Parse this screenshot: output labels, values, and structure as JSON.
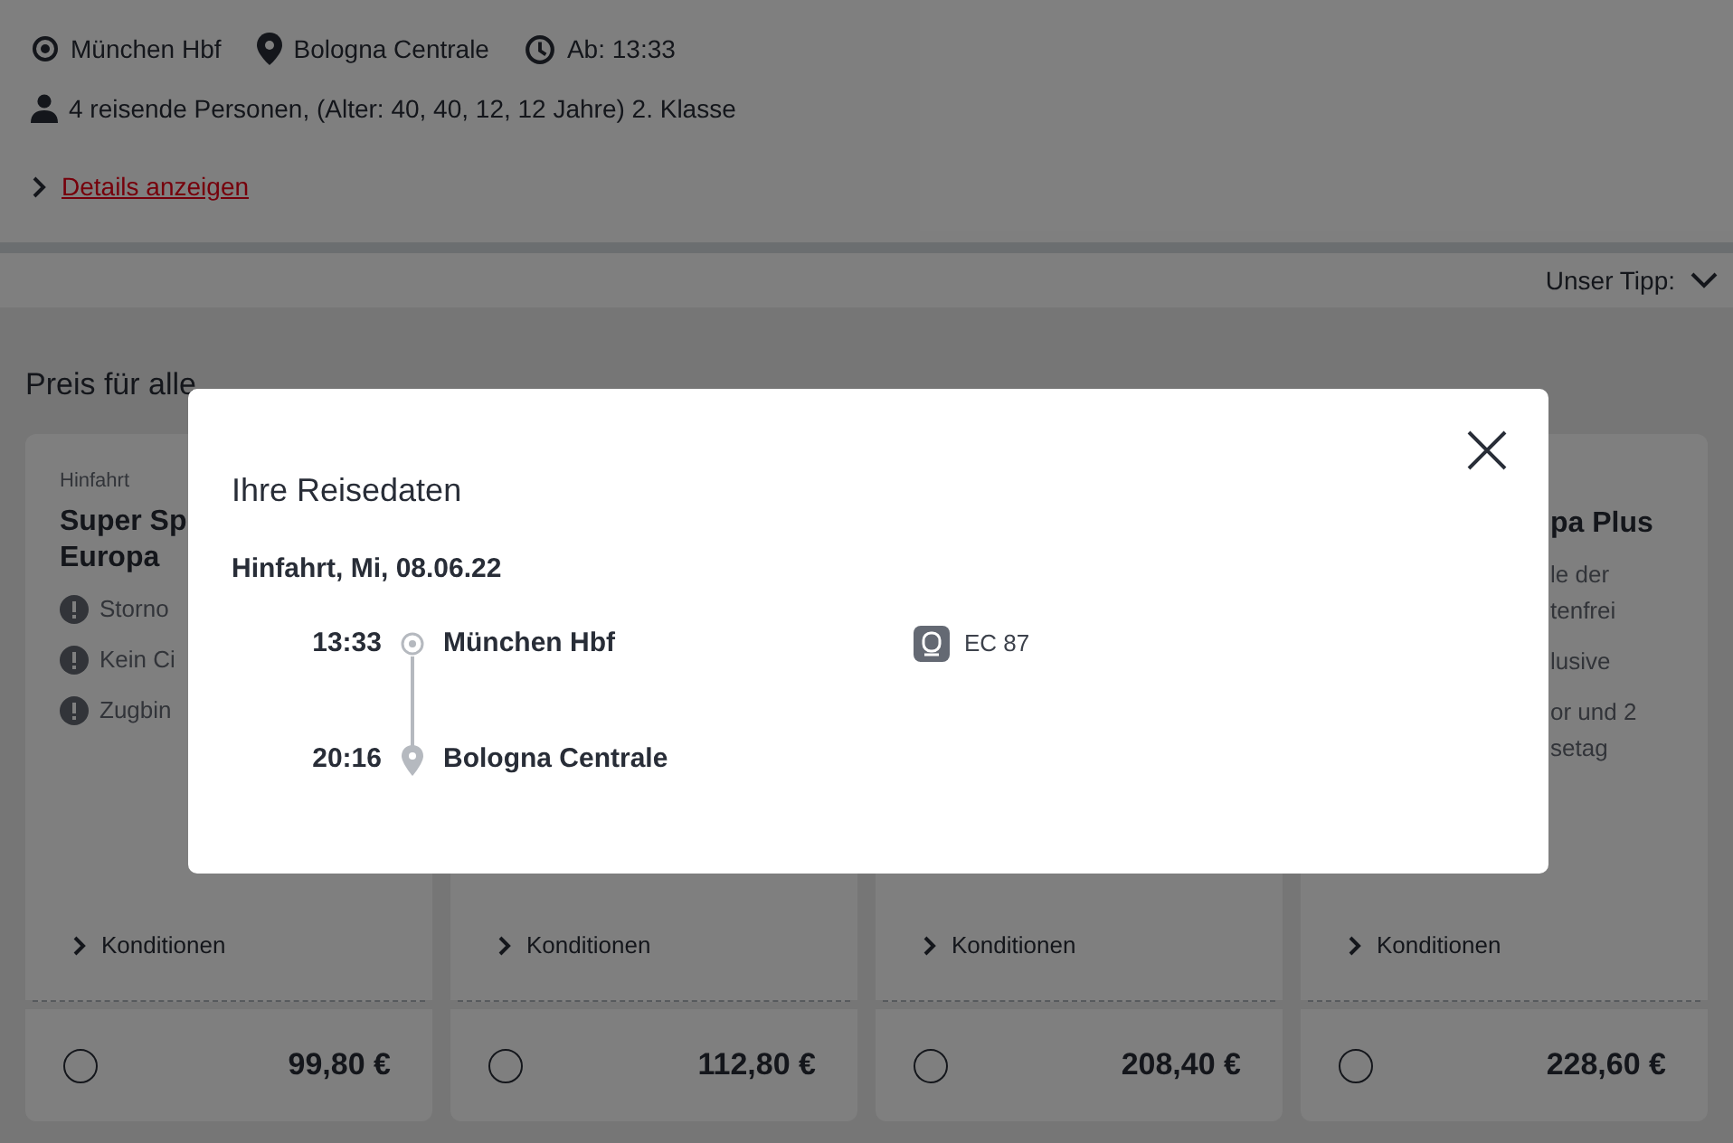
{
  "header": {
    "origin": "München Hbf",
    "destination": "Bologna Centrale",
    "departure": "Ab: 13:33",
    "travellers": "4 reisende Personen, (Alter: 40, 40, 12, 12 Jahre) 2. Klasse",
    "details_link": "Details anzeigen"
  },
  "sort": {
    "label": "Unser Tipp:"
  },
  "offers": {
    "heading": "Preis für alle",
    "cards": [
      {
        "kind": "left_visible",
        "direction": "Hinfahrt",
        "title_lines": [
          "Super Sp",
          "Europa"
        ],
        "features": [
          {
            "lines": [
              "Storno"
            ]
          },
          {
            "lines": [
              "Kein Ci"
            ]
          },
          {
            "lines": [
              "Zugbin"
            ]
          }
        ],
        "conditions": "Konditionen",
        "price": "99,80 €",
        "selected": false
      },
      {
        "kind": "hidden",
        "conditions": "Konditionen",
        "price": "112,80 €",
        "selected": false
      },
      {
        "kind": "hidden",
        "conditions": "Konditionen",
        "price": "208,40 €",
        "selected": false
      },
      {
        "kind": "right_visible",
        "title_lines": [
          "pa Plus"
        ],
        "features": [
          {
            "lines": [
              "le der",
              "tenfrei"
            ]
          },
          {
            "lines": [
              "lusive"
            ]
          },
          {
            "lines": [
              "or und 2",
              "setag"
            ]
          }
        ],
        "conditions": "Konditionen",
        "price": "228,60 €",
        "selected": false
      }
    ]
  },
  "modal": {
    "title": "Ihre Reisedaten",
    "leg": "Hinfahrt, Mi, 08.06.22",
    "stops": [
      {
        "kind": "origin",
        "time": "13:33",
        "station": "München Hbf"
      },
      {
        "kind": "destination",
        "time": "20:16",
        "station": "Bologna Centrale"
      }
    ],
    "train": "EC 87"
  }
}
